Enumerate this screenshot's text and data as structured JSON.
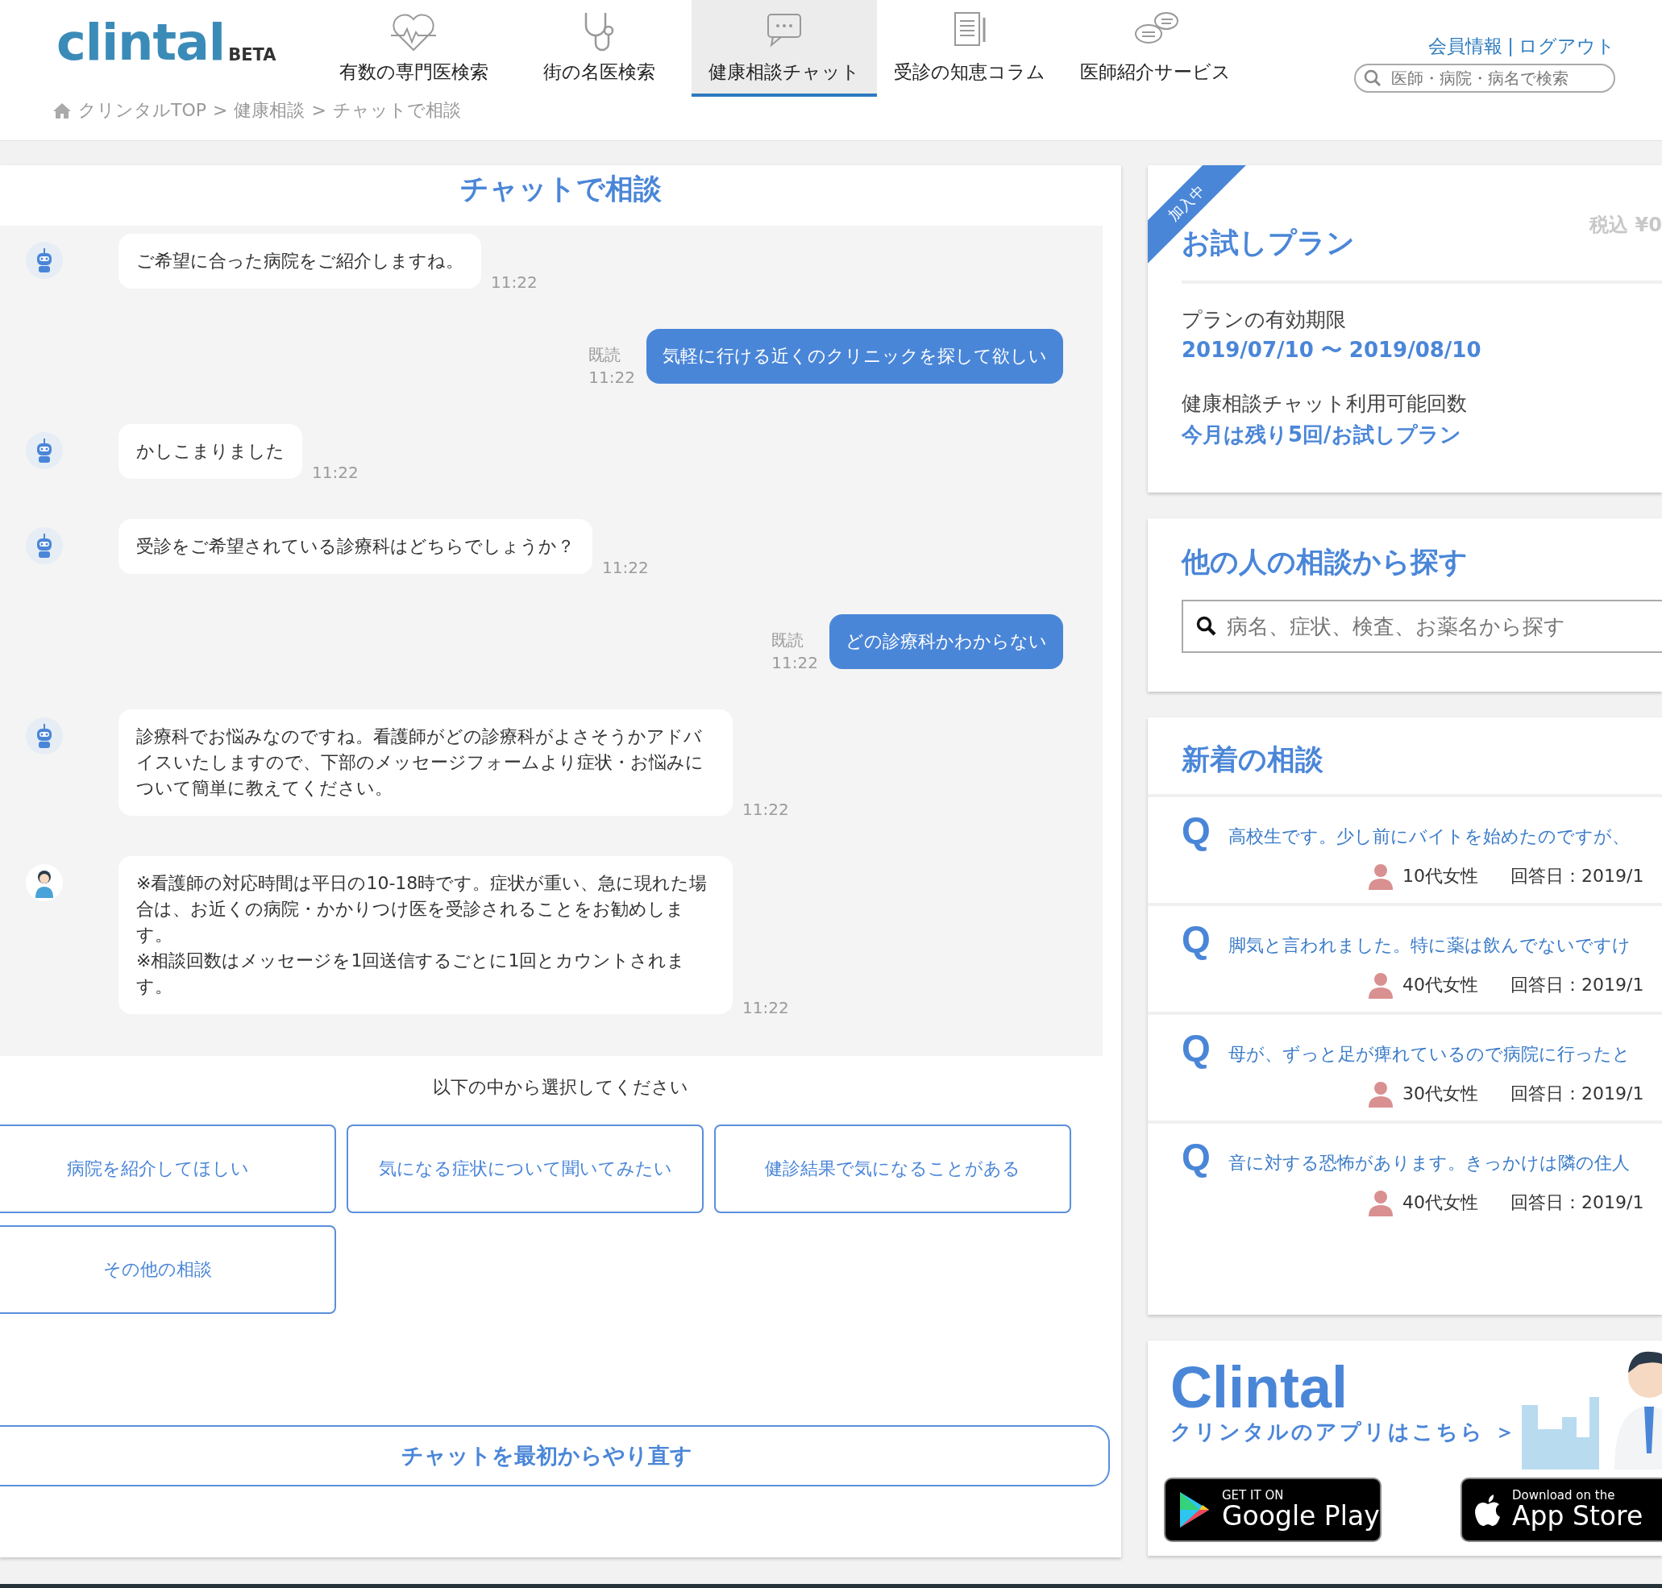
{
  "header": {
    "logo": {
      "text": "clintal",
      "badge": "BETA"
    },
    "nav": [
      {
        "label": "有数の専門医検索",
        "selected": false
      },
      {
        "label": "街の名医検索",
        "selected": false
      },
      {
        "label": "健康相談チャット",
        "selected": true
      },
      {
        "label": "受診の知恵コラム",
        "selected": false
      },
      {
        "label": "医師紹介サービス",
        "selected": false
      }
    ],
    "account_links": [
      "会員情報",
      "ログアウト"
    ],
    "account_separator": "|",
    "search": {
      "placeholder": "医師・病院・病名で検索"
    },
    "breadcrumb": {
      "items": [
        "クリンタルTOP",
        "健康相談",
        "チャットで相談"
      ],
      "separator": ">"
    }
  },
  "chat": {
    "title": "チャットで相談",
    "messages": [
      {
        "kind": "bot",
        "text": "ご希望に合った病院をご紹介しますね。",
        "time": "11:22"
      },
      {
        "kind": "user",
        "text": "気軽に行ける近くのクリニックを探して欲しい",
        "read": "既読",
        "time": "11:22"
      },
      {
        "kind": "bot",
        "text": "かしこまりました",
        "time": "11:22"
      },
      {
        "kind": "bot",
        "text": "受診をご希望されている診療科はどちらでしょうか？",
        "time": "11:22"
      },
      {
        "kind": "user",
        "text": "どの診療科かわからない",
        "read": "既読",
        "time": "11:22"
      },
      {
        "kind": "bot",
        "text": "診療科でお悩みなのですね。看護師がどの診療科がよさそうかアドバイスいたしますので、下部のメッセージフォームより症状・お悩みについて簡単に教えてください。",
        "time": "11:22"
      },
      {
        "kind": "nurse",
        "text": "※看護師の対応時間は平日の10-18時です。症状が重い、急に現れた場合は、お近くの病院・かかりつけ医を受診されることをお勧めします。\n※相談回数はメッセージを1回送信するごとに1回とカウントされます。",
        "time": "11:22"
      }
    ],
    "prompt": "以下の中から選択してください",
    "options": [
      "病院を紹介してほしい",
      "気になる症状について聞いてみたい",
      "健診結果で気になることがある",
      "その他の相談"
    ],
    "restart": "チャットを最初からやり直す"
  },
  "sidebar": {
    "plan": {
      "ribbon": "加入中",
      "name": "お試しプラン",
      "price": "税込 ¥0",
      "rows": [
        {
          "label": "プランの有効期限",
          "value": "2019/07/10 〜 2019/08/10"
        },
        {
          "label": "健康相談チャット利用可能回数",
          "value": "今月は残り5回/お試しプラン"
        }
      ]
    },
    "search": {
      "title": "他の人の相談から探す",
      "placeholder": "病名、症状、検査、お薬名から探す"
    },
    "recent": {
      "title": "新着の相談",
      "items": [
        {
          "mark": "Q",
          "text": "高校生です。少し前にバイトを始めたのですが、",
          "author": "10代女性",
          "date": "回答日：2019/1"
        },
        {
          "mark": "Q",
          "text": "脚気と言われました。特に薬は飲んでないですけ",
          "author": "40代女性",
          "date": "回答日：2019/1"
        },
        {
          "mark": "Q",
          "text": "母が、ずっと足が痺れているので病院に行ったと",
          "author": "30代女性",
          "date": "回答日：2019/1"
        },
        {
          "mark": "Q",
          "text": "音に対する恐怖があります。きっかけは隣の住人",
          "author": "40代女性",
          "date": "回答日：2019/1"
        }
      ]
    },
    "app": {
      "logo": "Clintal",
      "tagline": "クリンタルのアプリはこちら ＞",
      "badges": [
        {
          "kind": "google",
          "small": "GET IT ON",
          "big": "Google Play"
        },
        {
          "kind": "apple",
          "small": "Download on the",
          "big": "App Store"
        }
      ]
    }
  }
}
